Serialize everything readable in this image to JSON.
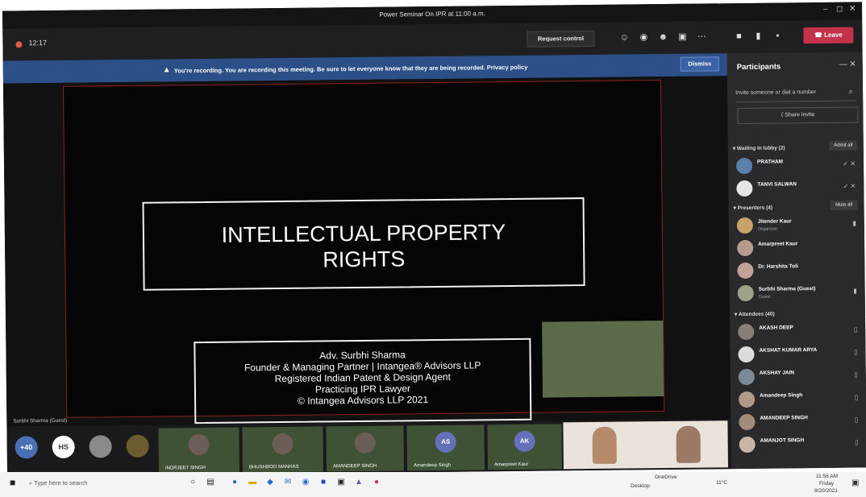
{
  "window": {
    "title": "Power Seminar On IPR at 11:00 a.m.",
    "minimize": "–",
    "maximize": "◻",
    "close": "✕"
  },
  "toolbar": {
    "timer": "12:17",
    "request_control": "Request control",
    "leave": "Leave",
    "icons": [
      "people-icon",
      "chat-icon",
      "reactions-icon",
      "rooms-icon",
      "more-icon",
      "camera-icon",
      "mic-icon",
      "share-icon"
    ]
  },
  "banner": {
    "text": "You're recording. You are recording this meeting. Be sure to let everyone know that they are being recorded. Privacy policy",
    "dismiss": "Dismiss",
    "color": "#2b4f86"
  },
  "slide": {
    "title_line1": "INTELLECTUAL PROPERTY",
    "title_line2": "RIGHTS",
    "info": [
      "Adv. Surbhi Sharma",
      "Founder & Managing Partner | Intangea® Advisors LLP",
      "Registered Indian Patent & Design Agent",
      "Practicing IPR Lawyer",
      "© Intangea Advisors LLP 2021"
    ]
  },
  "presenter_label": "Surbhi Sharma (Guest)",
  "strip": {
    "avatars": [
      {
        "initials": "+40",
        "color": "#4a6fb3"
      },
      {
        "initials": "HS",
        "color": "#ffffff"
      },
      {
        "initials": "",
        "color": "#8a8a8a"
      },
      {
        "initials": "",
        "color": "#6d5a2e"
      }
    ],
    "tiles": [
      {
        "name": "INDRJEET SINGH",
        "initials": ""
      },
      {
        "name": "BHUSHBOO MANHAS",
        "initials": ""
      },
      {
        "name": "AMANDEEP SINGH",
        "initials": ""
      },
      {
        "name": "Amandeep Singh",
        "initials": "AS"
      },
      {
        "name": "Amarpreet Kaur",
        "initials": "AK"
      }
    ]
  },
  "participants": {
    "title": "Participants",
    "invite_placeholder": "Invite someone or dial a number",
    "share_invite": "Share invite",
    "lobby": {
      "heading": "Waiting in lobby (2)",
      "action": "Admit all",
      "people": [
        {
          "name": "PRATHAM",
          "sub": ""
        },
        {
          "name": "TANVI SALWAN",
          "sub": ""
        }
      ]
    },
    "presenters": {
      "heading": "Presenters (4)",
      "action": "Mute all",
      "people": [
        {
          "name": "Jitender Kaur",
          "sub": "Organizer"
        },
        {
          "name": "Amarpreet Kaur",
          "sub": ""
        },
        {
          "name": "Dr. Harshita Toli",
          "sub": ""
        },
        {
          "name": "Surbhi Sharma (Guest)",
          "sub": "Guest"
        }
      ]
    },
    "attendees": {
      "heading": "Attendees (40)",
      "people": [
        {
          "name": "AKASH DEEP",
          "sub": ""
        },
        {
          "name": "AKSHAT KUMAR ARYA",
          "sub": ""
        },
        {
          "name": "AKSHAY JAIN",
          "sub": ""
        },
        {
          "name": "Amandeep Singh",
          "sub": ""
        },
        {
          "name": "AMANDEEP SINGH",
          "sub": ""
        },
        {
          "name": "AMANJOT SINGH",
          "sub": ""
        }
      ]
    }
  },
  "taskbar": {
    "search_placeholder": "Type here to search",
    "onedrive": "OneDrive",
    "desktop": "Desktop",
    "temp": "11°C",
    "time": "11:56 AM",
    "day": "Friday",
    "date": "8/20/2021"
  }
}
